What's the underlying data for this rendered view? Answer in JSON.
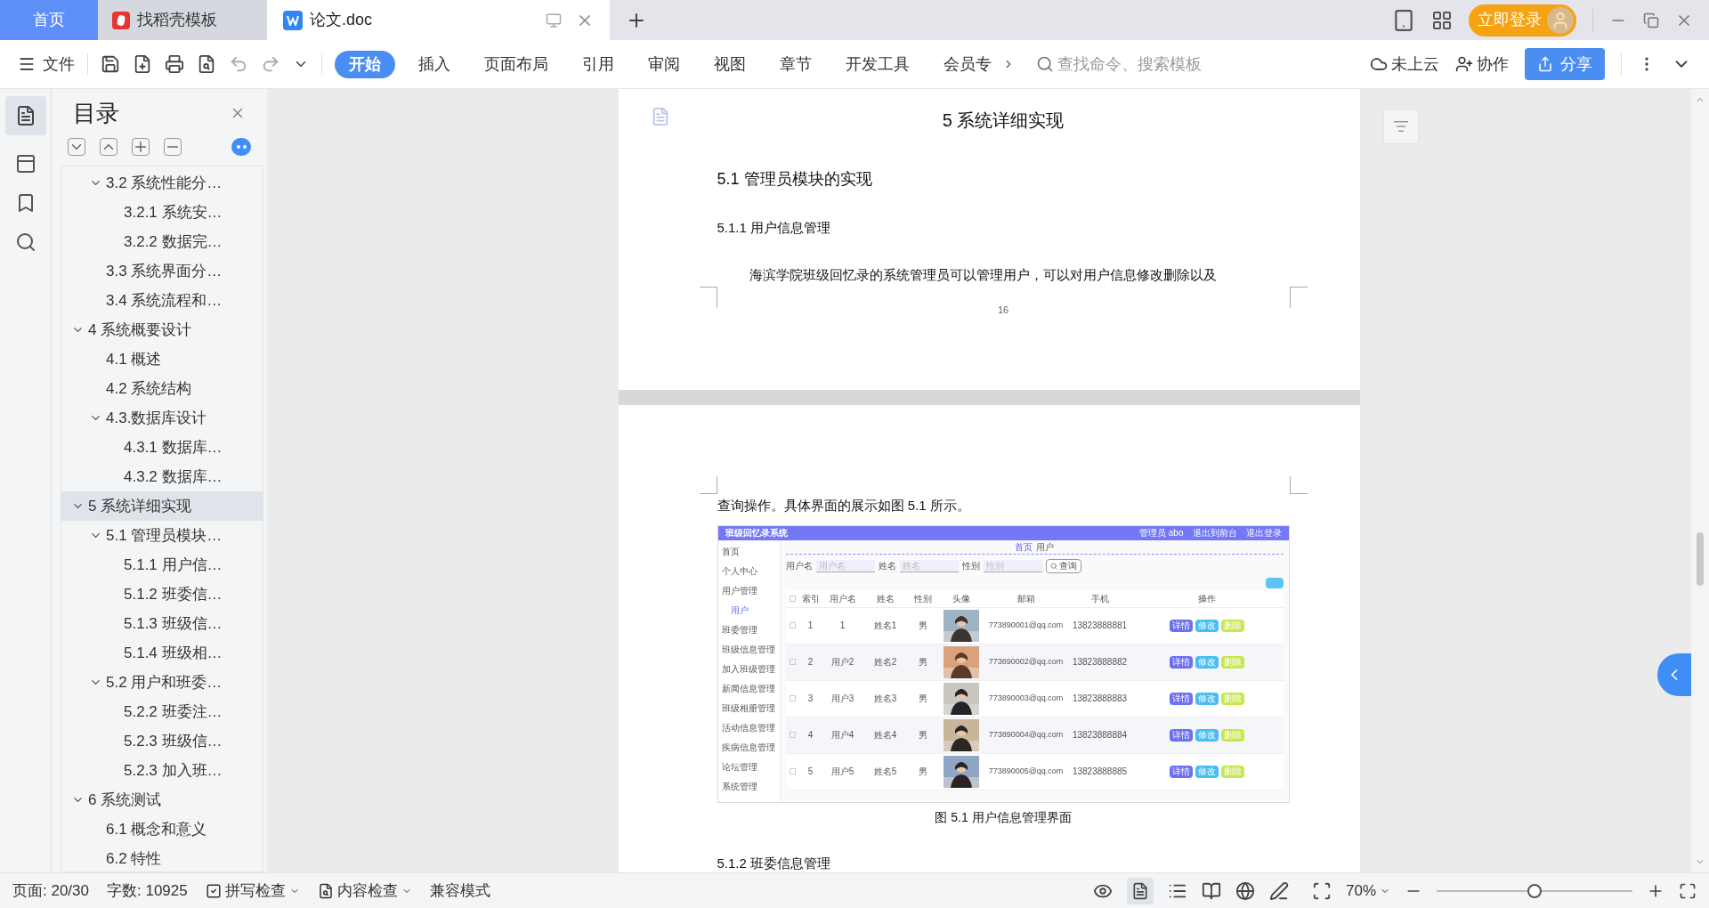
{
  "tabs": [
    {
      "label": "首页",
      "kind": "home",
      "selected": false
    },
    {
      "label": "找稻壳模板",
      "kind": "template",
      "selected": false
    },
    {
      "label": "论文.doc",
      "kind": "document",
      "selected": true
    }
  ],
  "account": {
    "login": "立即登录"
  },
  "menu": {
    "file": "文件",
    "tabs": [
      {
        "label": "开始",
        "selected": true
      },
      {
        "label": "插入",
        "selected": false
      },
      {
        "label": "页面布局",
        "selected": false
      },
      {
        "label": "引用",
        "selected": false
      },
      {
        "label": "审阅",
        "selected": false
      },
      {
        "label": "视图",
        "selected": false
      },
      {
        "label": "章节",
        "selected": false
      },
      {
        "label": "开发工具",
        "selected": false
      },
      {
        "label": "会员专",
        "selected": false
      }
    ],
    "search": {
      "placeholder": "查找命令、搜索模板"
    },
    "cloud": "未上云",
    "collab": "协作",
    "share": "分享"
  },
  "outline": {
    "title": "目录",
    "partial": [
      {
        "text": "3.2 系统性能分…",
        "selected": false,
        "expanded": true,
        "children": [
          {
            "text": "3.2.1  系统安…",
            "selected": false
          },
          {
            "text": "3.2.2  数据完…",
            "selected": false
          }
        ]
      },
      {
        "text": "3.3 系统界面分…",
        "selected": false
      },
      {
        "text": "3.4 系统流程和…",
        "selected": false
      }
    ],
    "items": [
      {
        "text": "4 系统概要设计",
        "selected": false,
        "expanded": true,
        "children": [
          {
            "text": "4.1 概述",
            "selected": false
          },
          {
            "text": "4.2 系统结构",
            "selected": false
          },
          {
            "text": "4.3.数据库设计",
            "selected": false,
            "expanded": true,
            "children": [
              {
                "text": "4.3.1 数据库…",
                "selected": false
              },
              {
                "text": "4.3.2 数据库…",
                "selected": false
              }
            ]
          }
        ]
      },
      {
        "text": "5 系统详细实现",
        "selected": true,
        "expanded": true,
        "children": [
          {
            "text": "5.1  管理员模块…",
            "selected": false,
            "expanded": true,
            "children": [
              {
                "text": "5.1.1  用户信…",
                "selected": false
              },
              {
                "text": "5.1.2  班委信…",
                "selected": false
              },
              {
                "text": "5.1.3  班级信…",
                "selected": false
              },
              {
                "text": "5.1.4  班级相…",
                "selected": false
              }
            ]
          },
          {
            "text": "5.2  用户和班委…",
            "selected": false,
            "expanded": true,
            "children": [
              {
                "text": "5.2.2  班委注…",
                "selected": false
              },
              {
                "text": "5.2.3  班级信…",
                "selected": false
              },
              {
                "text": "5.2.3  加入班…",
                "selected": false
              }
            ]
          }
        ]
      },
      {
        "text": "6 系统测试",
        "selected": false,
        "expanded": true,
        "children": [
          {
            "text": "6.1 概念和意义",
            "selected": false
          },
          {
            "text": "6.2 特性",
            "selected": false
          }
        ]
      }
    ]
  },
  "document": {
    "page1": {
      "chapter_title": "5 系统详细实现",
      "section": "5.1  管理员模块的实现",
      "subsection": "5.1.1  用户信息管理",
      "paragraph": "海滨学院班级回忆录的系统管理员可以管理用户，可以对用户信息修改删除以及",
      "page_number": "16"
    },
    "page2": {
      "paragraph": "查询操作。具体界面的展示如图 5.1 所示。",
      "figure": {
        "title": "班级回忆录系统",
        "header_links": [
          "管理员 abo",
          "退出到前台",
          "退出登录"
        ],
        "menu": [
          {
            "label": "首页",
            "selected": false
          },
          {
            "label": "个人中心",
            "selected": false
          },
          {
            "label": "用户管理",
            "selected": false
          },
          {
            "label": "用户",
            "selected": true
          },
          {
            "label": "班委管理",
            "selected": false
          },
          {
            "label": "班级信息管理",
            "selected": false
          },
          {
            "label": "加入班级管理",
            "selected": false
          },
          {
            "label": "新闻信息管理",
            "selected": false
          },
          {
            "label": "班级相册管理",
            "selected": false
          },
          {
            "label": "活动信息管理",
            "selected": false
          },
          {
            "label": "疾病信息管理",
            "selected": false
          },
          {
            "label": "论坛管理",
            "selected": false
          },
          {
            "label": "系统管理",
            "selected": false
          }
        ],
        "breadcrumb": [
          "首页",
          "用户"
        ],
        "filters": [
          {
            "label": "用户名",
            "placeholder": "用户名"
          },
          {
            "label": "姓名",
            "placeholder": "姓名"
          },
          {
            "label": "性别",
            "placeholder": "性别"
          }
        ],
        "search_button": "查询",
        "select_all_checked": false,
        "columns": [
          "索引",
          "用户名",
          "姓名",
          "性别",
          "头像",
          "邮箱",
          "手机",
          "操作"
        ],
        "rows": [
          {
            "checked": false,
            "cells": [
              "1",
              "1",
              "姓名1",
              "男"
            ],
            "email": "773890001@qq.com",
            "phone": "13823888881",
            "actions": [
              "详情",
              "修改",
              "删除"
            ]
          },
          {
            "checked": false,
            "cells": [
              "2",
              "用户2",
              "姓名2",
              "男"
            ],
            "email": "773890002@qq.com",
            "phone": "13823888882",
            "actions": [
              "详情",
              "修改",
              "删除"
            ]
          },
          {
            "checked": false,
            "cells": [
              "3",
              "用户3",
              "姓名3",
              "男"
            ],
            "email": "773890003@qq.com",
            "phone": "13823888883",
            "actions": [
              "详情",
              "修改",
              "删除"
            ]
          },
          {
            "checked": false,
            "cells": [
              "4",
              "用户4",
              "姓名4",
              "男"
            ],
            "email": "773890004@qq.com",
            "phone": "13823888884",
            "actions": [
              "详情",
              "修改",
              "删除"
            ]
          },
          {
            "checked": false,
            "cells": [
              "5",
              "用户5",
              "姓名5",
              "男"
            ],
            "email": "773890005@qq.com",
            "phone": "13823888885",
            "actions": [
              "详情",
              "修改",
              "删除"
            ]
          }
        ]
      },
      "caption": "图 5.1  用户信息管理界面",
      "next_heading": "5.1.2  班委信息管理"
    }
  },
  "status_bar": {
    "page": "页面: 20/30",
    "words": "字数: 10925",
    "spell": "拼写检查",
    "content": "内容检查",
    "compat": "兼容模式",
    "zoom": "70%",
    "zoom_slider": {
      "level": 0.5
    }
  }
}
